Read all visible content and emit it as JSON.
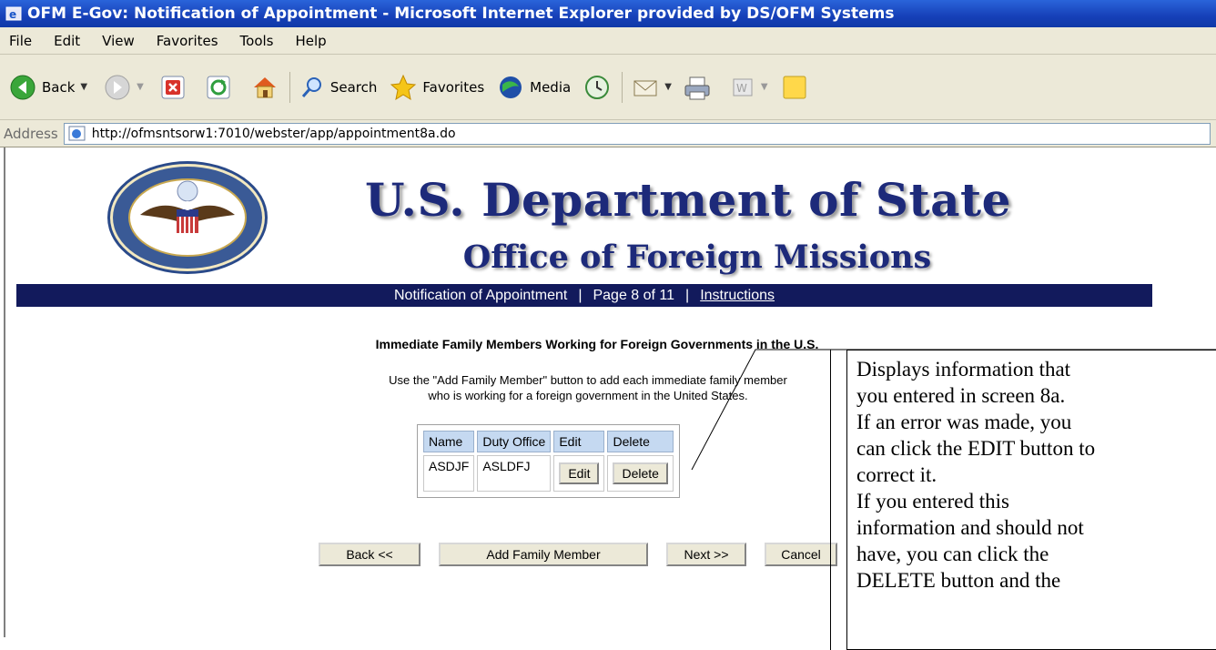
{
  "window": {
    "title": "OFM E-Gov: Notification of Appointment - Microsoft Internet Explorer provided by DS/OFM Systems"
  },
  "menu": [
    "File",
    "Edit",
    "View",
    "Favorites",
    "Tools",
    "Help"
  ],
  "toolbar": {
    "back": "Back",
    "search": "Search",
    "favorites": "Favorites",
    "media": "Media"
  },
  "address": {
    "label": "Address",
    "url": "http://ofmsntsorw1:7010/webster/app/appointment8a.do"
  },
  "page": {
    "title": "U.S. Department of State",
    "subtitle": "Office of Foreign Missions",
    "nav": {
      "form": "Notification of Appointment",
      "page": "Page 8 of 11",
      "instructions": "Instructions"
    },
    "section_title": "Immediate Family Members Working for Foreign Governments in the U.S.",
    "instructions_line1": "Use the \"Add Family Member\" button to add each immediate family member",
    "instructions_line2": "who is working for a foreign government in the United States.",
    "table": {
      "headers": [
        "Name",
        "Duty Office",
        "Edit",
        "Delete"
      ],
      "rows": [
        {
          "name": "ASDJF",
          "duty_office": "ASLDFJ",
          "edit": "Edit",
          "delete": "Delete"
        }
      ]
    },
    "buttons": {
      "back": "Back <<",
      "add": "Add Family Member",
      "next": "Next >>",
      "cancel": "Cancel"
    }
  },
  "callout": {
    "lines": [
      "Displays information that",
      "you entered in screen 8a.",
      "If an error was made, you",
      "can click the EDIT button to",
      "correct it.",
      "If you entered this",
      "information and should not",
      "have, you can click the",
      "DELETE button and the"
    ]
  }
}
